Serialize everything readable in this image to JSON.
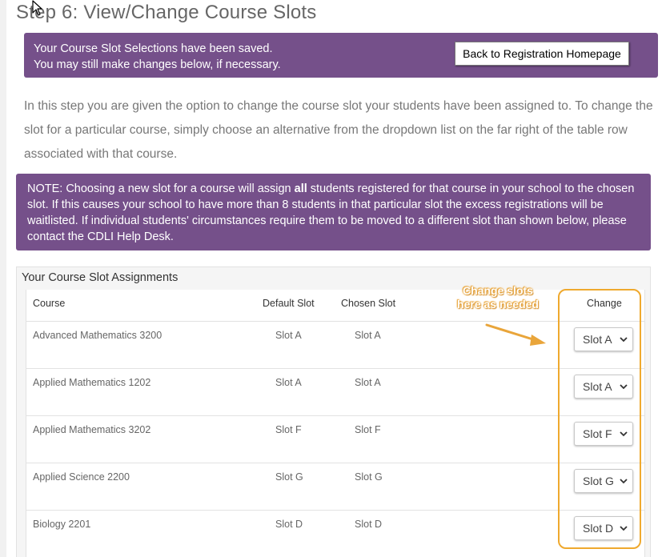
{
  "page": {
    "title": "Step 6: View/Change Course Slots"
  },
  "saved_banner": {
    "line1": "Your Course Slot Selections have been saved.",
    "line2": "You may still make changes below, if necessary.",
    "back_button_label": "Back to Registration Homepage"
  },
  "intro": {
    "text": "In this step you are given the option to change the course slot your students have been assigned to. To change the slot for a particular course, simply choose an alternative from the dropdown list on the far right of the table row associated with that course."
  },
  "note": {
    "before_bold": "NOTE: Choosing a new slot for a course will assign ",
    "bold": "all",
    "after_bold": " students registered for that course in your school to the chosen slot. If this causes your school to have more than 8 students in that particular slot the excess registrations will be waitlisted. If individual students' circumstances require them to be moved to a different slot than shown below, please contact the CDLI Help Desk."
  },
  "table": {
    "title": "Your Course Slot Assignments",
    "headers": {
      "course": "Course",
      "default_slot": "Default Slot",
      "chosen_slot": "Chosen Slot",
      "change": "Change"
    },
    "rows": [
      {
        "course": "Advanced Mathematics 3200",
        "default_slot": "Slot A",
        "chosen_slot": "Slot A",
        "change": "Slot A"
      },
      {
        "course": "Applied Mathematics 1202",
        "default_slot": "Slot A",
        "chosen_slot": "Slot A",
        "change": "Slot A"
      },
      {
        "course": "Applied Mathematics 3202",
        "default_slot": "Slot F",
        "chosen_slot": "Slot F",
        "change": "Slot F"
      },
      {
        "course": "Applied Science 2200",
        "default_slot": "Slot G",
        "chosen_slot": "Slot G",
        "change": "Slot G"
      },
      {
        "course": "Biology 2201",
        "default_slot": "Slot D",
        "chosen_slot": "Slot D",
        "change": "Slot D"
      }
    ]
  },
  "annotation": {
    "line1": "Change slots",
    "line2": "here as needed"
  },
  "colors": {
    "banner_purple": "#75508a",
    "highlight_orange": "#efa92e"
  }
}
